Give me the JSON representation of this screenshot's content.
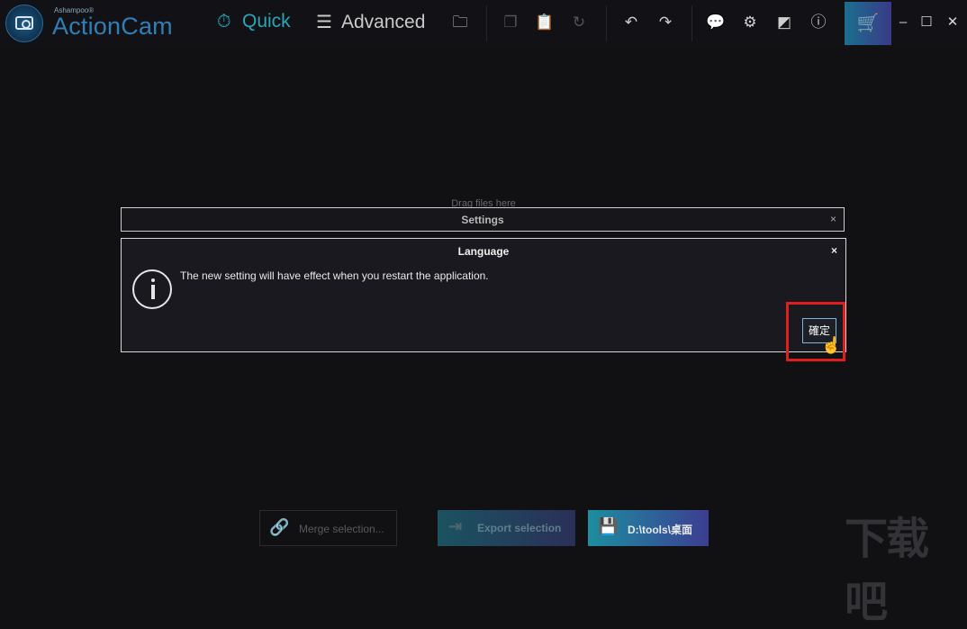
{
  "brand": {
    "small": "Ashampoo®",
    "name": "ActionCam"
  },
  "modes": {
    "quick": "Quick",
    "advanced": "Advanced"
  },
  "icons": {
    "logo": "camera-logo-icon",
    "quick": "stopwatch-icon",
    "advanced": "sliders-icon",
    "folder": "folder-icon",
    "copy": "copy-icon",
    "paste": "clipboard-icon",
    "reset": "rotate-icon",
    "undo": "undo-icon",
    "redo": "redo-icon",
    "feedback": "chat-icon",
    "settings": "gear-icon",
    "display": "display-icon",
    "info": "info-icon",
    "cart": "cart-icon",
    "minimize": "minimize-icon",
    "maximize": "maximize-icon",
    "close": "close-icon"
  },
  "glyphs": {
    "quick": "⏱",
    "advanced": "☰",
    "folder": "🗀",
    "copy": "❐",
    "paste": "📋",
    "reset": "↻",
    "undo": "↶",
    "redo": "↷",
    "feedback": "💬",
    "settings": "⚙",
    "display": "◩",
    "info": "ⓘ",
    "cart": "🛒",
    "minimize": "–",
    "maximize": "☐",
    "close": "✕",
    "dialog_close": "×",
    "cursor": "☝",
    "link": "🔗",
    "export": "⇥",
    "save": "💾"
  },
  "drag_hint": "Drag files here",
  "settings_dialog": {
    "title": "Settings"
  },
  "language_dialog": {
    "title": "Language",
    "message": "The new setting will have effect when you restart the application.",
    "ok_label": "確定"
  },
  "bottom": {
    "merge_label": "Merge selection...",
    "export_label": "Export selection",
    "save_label": "D:\\tools\\桌面"
  },
  "watermark": "下载吧",
  "colors": {
    "accent": "#2aa6b8",
    "brand": "#2f7fb6",
    "highlight": "#e01e1e"
  }
}
